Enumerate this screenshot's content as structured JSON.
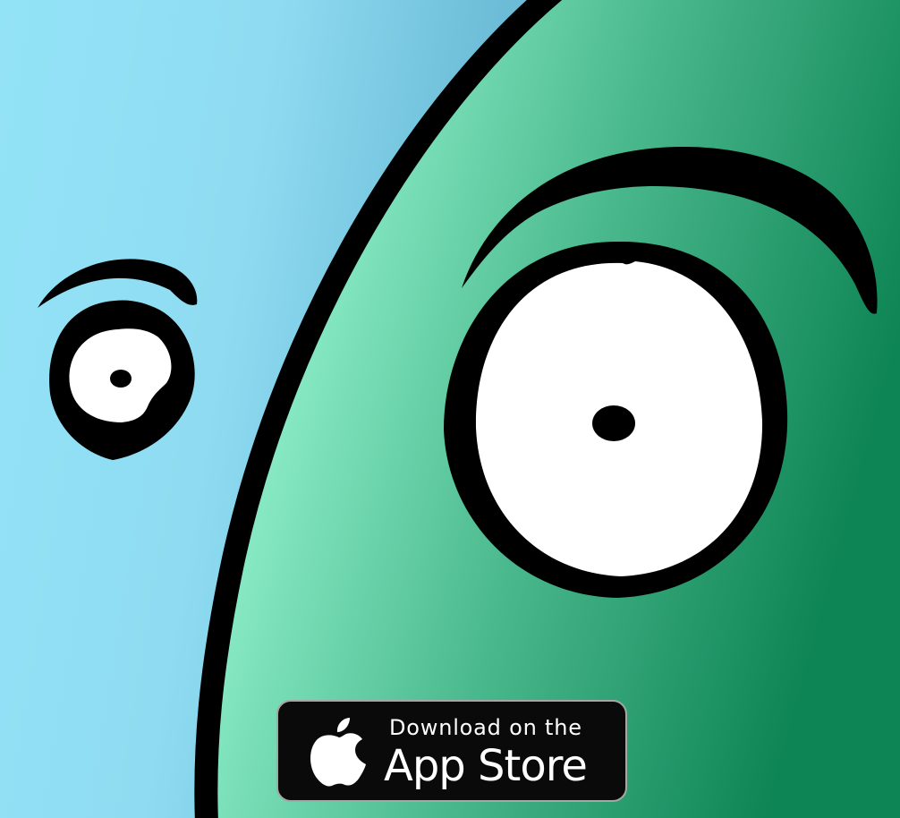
{
  "colors": {
    "sky_light": "#92e2f6",
    "sky_dark": "#62b0cd",
    "body_light": "#82e6be",
    "body_dark": "#0f8656",
    "outline": "#000000",
    "eye_white": "#ffffff",
    "badge_bg": "#0a0a0a",
    "badge_border": "#a6a6a6"
  },
  "illustration": {
    "small_creature": {
      "eye_icon": "eye-icon",
      "brow_icon": "eyebrow-icon"
    },
    "big_creature": {
      "eye_icon": "eye-icon",
      "brow_icon": "eyebrow-icon"
    }
  },
  "badge": {
    "icon": "apple-logo-icon",
    "line1": "Download on the",
    "line2": "App Store"
  }
}
